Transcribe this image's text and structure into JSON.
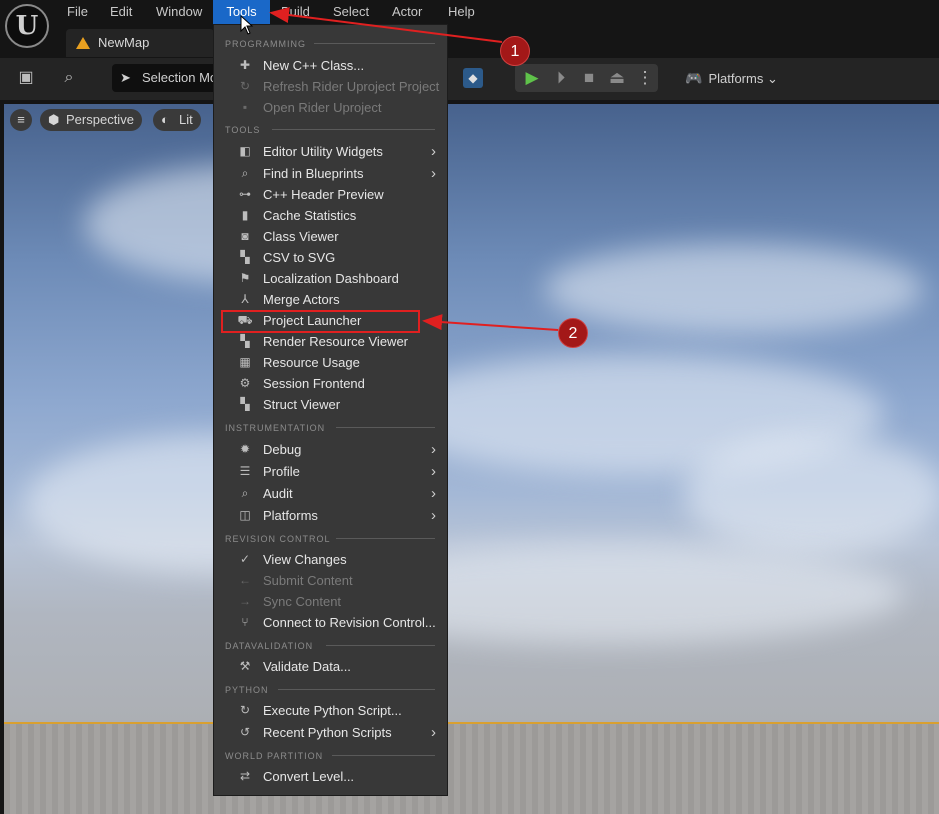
{
  "menubar": {
    "items": [
      "File",
      "Edit",
      "Window",
      "Tools",
      "Build",
      "Select",
      "Actor",
      "Help"
    ],
    "active": "Tools"
  },
  "tab": {
    "title": "NewMap"
  },
  "toolbar": {
    "mode_label": "Selection Mo",
    "platforms_label": "Platforms"
  },
  "viewport": {
    "perspective_label": "Perspective",
    "lit_label": "Lit"
  },
  "menu": {
    "sections": {
      "programming": "PROGRAMMING",
      "tools": "TOOLS",
      "instrumentation": "INSTRUMENTATION",
      "revision_control": "REVISION CONTROL",
      "datavalidation": "DATAVALIDATION",
      "python": "PYTHON",
      "world_partition": "WORLD PARTITION"
    },
    "items": [
      {
        "label": "New C++ Class...",
        "icon": "class-icon",
        "disabled": false,
        "submenu": false
      },
      {
        "label": "Refresh Rider Uproject Project",
        "icon": "refresh-icon",
        "disabled": true,
        "submenu": false
      },
      {
        "label": "Open Rider Uproject",
        "icon": "rider-icon",
        "disabled": true,
        "submenu": false
      },
      {
        "label": "Editor Utility Widgets",
        "icon": "widget-icon",
        "disabled": false,
        "submenu": true
      },
      {
        "label": "Find in Blueprints",
        "icon": "find-icon",
        "disabled": false,
        "submenu": true
      },
      {
        "label": "C++ Header Preview",
        "icon": "header-icon",
        "disabled": false,
        "submenu": false
      },
      {
        "label": "Cache Statistics",
        "icon": "statistics-icon",
        "disabled": false,
        "submenu": false
      },
      {
        "label": "Class Viewer",
        "icon": "class-viewer-icon",
        "disabled": false,
        "submenu": false
      },
      {
        "label": "CSV to SVG",
        "icon": "csv-icon",
        "disabled": false,
        "submenu": false
      },
      {
        "label": "Localization Dashboard",
        "icon": "flag-icon",
        "disabled": false,
        "submenu": false
      },
      {
        "label": "Merge Actors",
        "icon": "merge-icon",
        "disabled": false,
        "submenu": false
      },
      {
        "label": "Project Launcher",
        "icon": "launcher-icon",
        "disabled": false,
        "submenu": false
      },
      {
        "label": "Render Resource Viewer",
        "icon": "render-icon",
        "disabled": false,
        "submenu": false
      },
      {
        "label": "Resource Usage",
        "icon": "table-icon",
        "disabled": false,
        "submenu": false
      },
      {
        "label": "Session Frontend",
        "icon": "session-icon",
        "disabled": false,
        "submenu": false
      },
      {
        "label": "Struct Viewer",
        "icon": "struct-icon",
        "disabled": false,
        "submenu": false
      },
      {
        "label": "Debug",
        "icon": "debug-icon",
        "disabled": false,
        "submenu": true
      },
      {
        "label": "Profile",
        "icon": "profile-icon",
        "disabled": false,
        "submenu": true
      },
      {
        "label": "Audit",
        "icon": "audit-icon",
        "disabled": false,
        "submenu": true
      },
      {
        "label": "Platforms",
        "icon": "platforms-icon",
        "disabled": false,
        "submenu": true
      },
      {
        "label": "View Changes",
        "icon": "check-icon",
        "disabled": false,
        "submenu": false
      },
      {
        "label": "Submit Content",
        "icon": "arrow-left-icon",
        "disabled": true,
        "submenu": false
      },
      {
        "label": "Sync Content",
        "icon": "arrow-right-icon",
        "disabled": true,
        "submenu": false
      },
      {
        "label": "Connect to Revision Control...",
        "icon": "branch-icon",
        "disabled": false,
        "submenu": false
      },
      {
        "label": "Validate Data...",
        "icon": "validate-icon",
        "disabled": false,
        "submenu": false
      },
      {
        "label": "Execute Python Script...",
        "icon": "python-icon",
        "disabled": false,
        "submenu": false
      },
      {
        "label": "Recent Python Scripts",
        "icon": "recent-icon",
        "disabled": false,
        "submenu": true
      },
      {
        "label": "Convert Level...",
        "icon": "convert-icon",
        "disabled": false,
        "submenu": false
      }
    ]
  },
  "annotations": [
    {
      "number": "1"
    },
    {
      "number": "2"
    }
  ],
  "colors": {
    "accent": "#1a68c8",
    "highlight": "#e02020",
    "badge": "#a31818"
  }
}
